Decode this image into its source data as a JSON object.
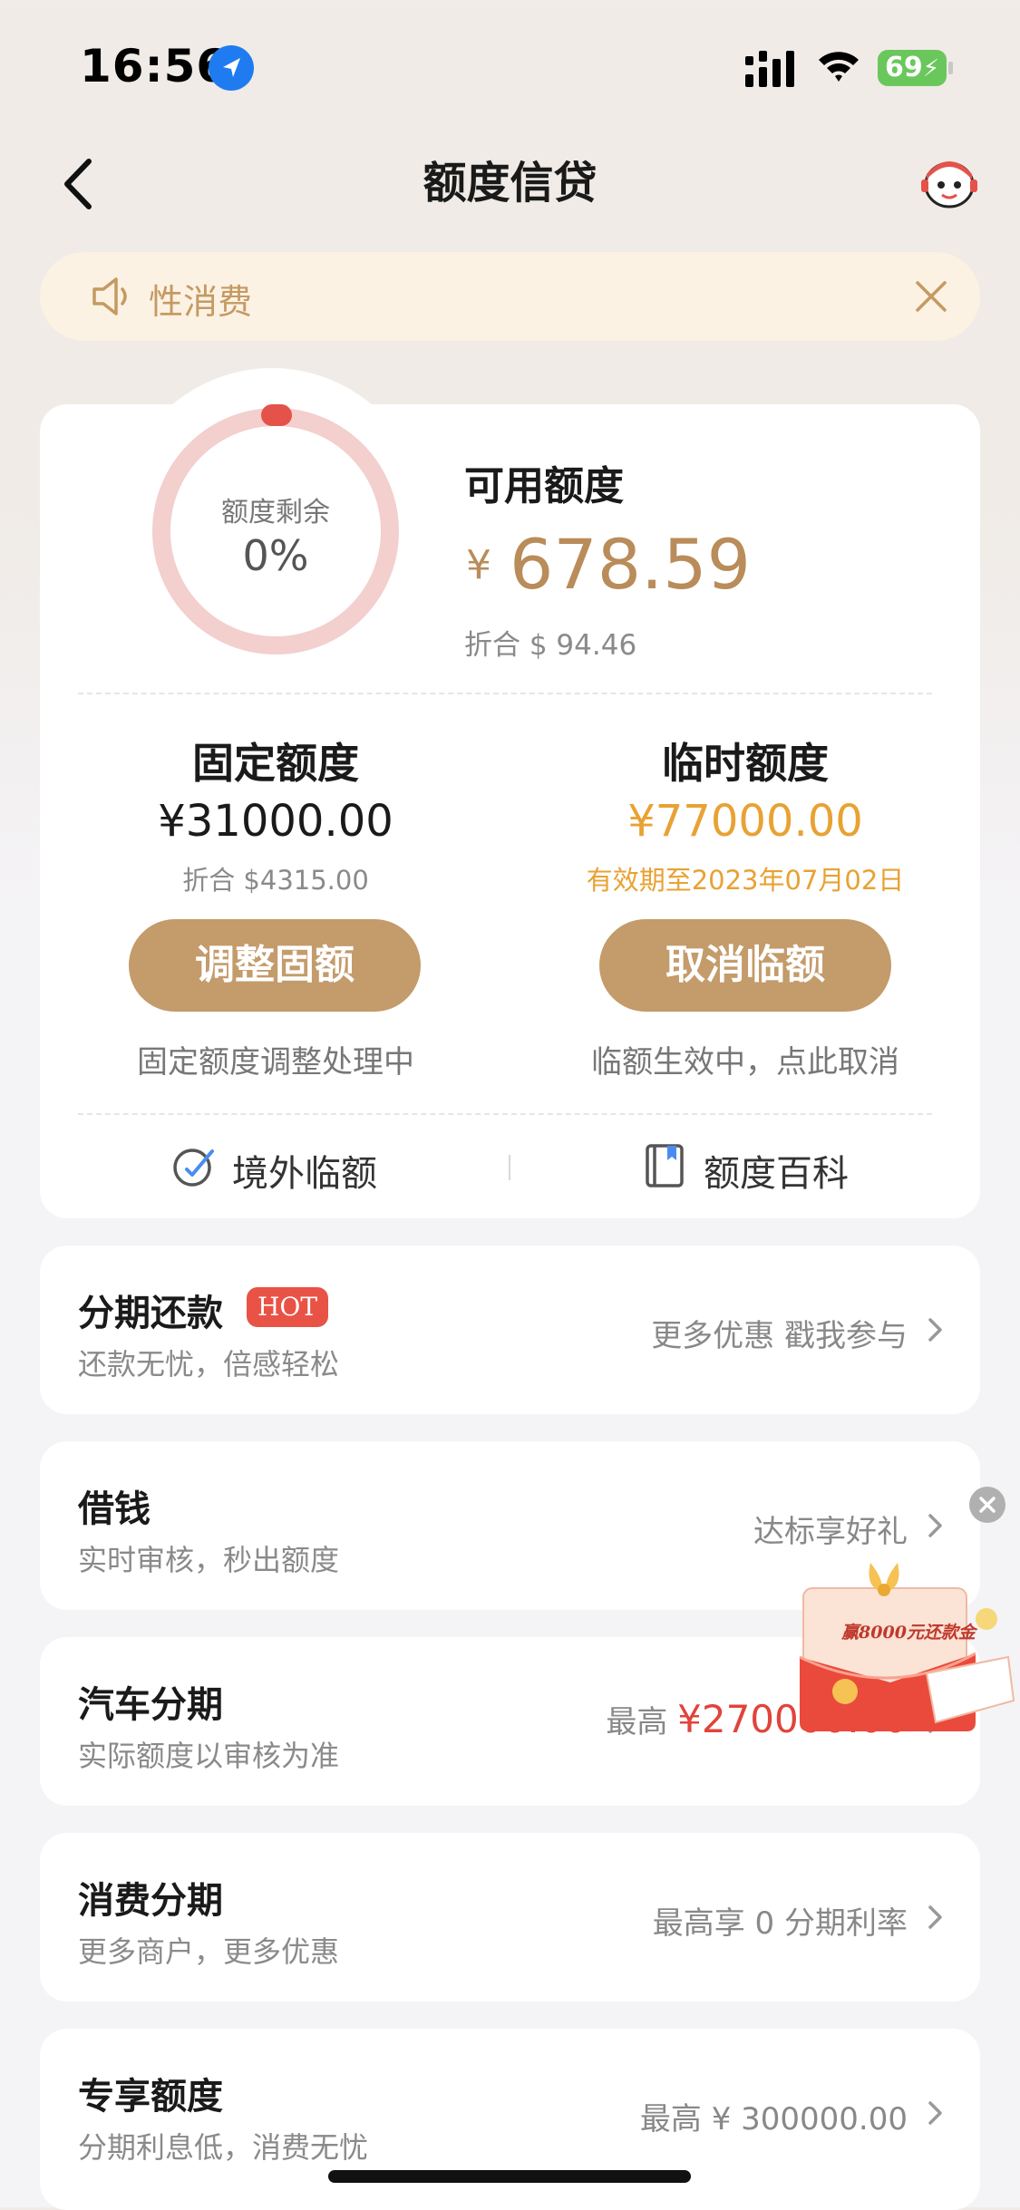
{
  "status_bar": {
    "time": "16:56",
    "battery": "69"
  },
  "nav": {
    "title": "额度信贷"
  },
  "notice": {
    "text": "性消费"
  },
  "summary": {
    "ring_label": "额度剩余",
    "ring_percent": "0%",
    "ring_value_fraction": 0,
    "available_label": "可用额度",
    "currency_symbol": "¥",
    "available_amount": "678.59",
    "available_converted": "折合 $ 94.46"
  },
  "fixed": {
    "title": "固定额度",
    "amount": "¥31000.00",
    "converted": "折合 $4315.00",
    "button": "调整固额",
    "note": "固定额度调整处理中"
  },
  "temporary": {
    "title": "临时额度",
    "amount": "¥77000.00",
    "validity": "有效期至2023年07月02日",
    "button": "取消临额",
    "note": "临额生效中，点此取消"
  },
  "links": {
    "overseas": "境外临额",
    "wiki": "额度百科"
  },
  "services": [
    {
      "title": "分期还款",
      "badge": "HOT",
      "subtitle": "还款无忧，倍感轻松",
      "right": "更多优惠 戳我参与"
    },
    {
      "title": "借钱",
      "subtitle": "实时审核，秒出额度",
      "right": "达标享好礼"
    },
    {
      "title": "汽车分期",
      "subtitle": "实际额度以审核为准",
      "right_prefix": "最高",
      "right_amount": "¥270000.00"
    },
    {
      "title": "消费分期",
      "subtitle": "更多商户，更多优惠",
      "right": "最高享 0 分期利率"
    },
    {
      "title": "专享额度",
      "subtitle": "分期利息低，消费无忧",
      "right": "最高 ¥ 300000.00"
    }
  ],
  "promo": {
    "text": "赢8000元还款金"
  },
  "colors": {
    "gold": "#c49b6a",
    "orange": "#e8a233",
    "red": "#e0443b",
    "ring_track": "#f3cfcd",
    "ring_dot": "#e5524a"
  }
}
